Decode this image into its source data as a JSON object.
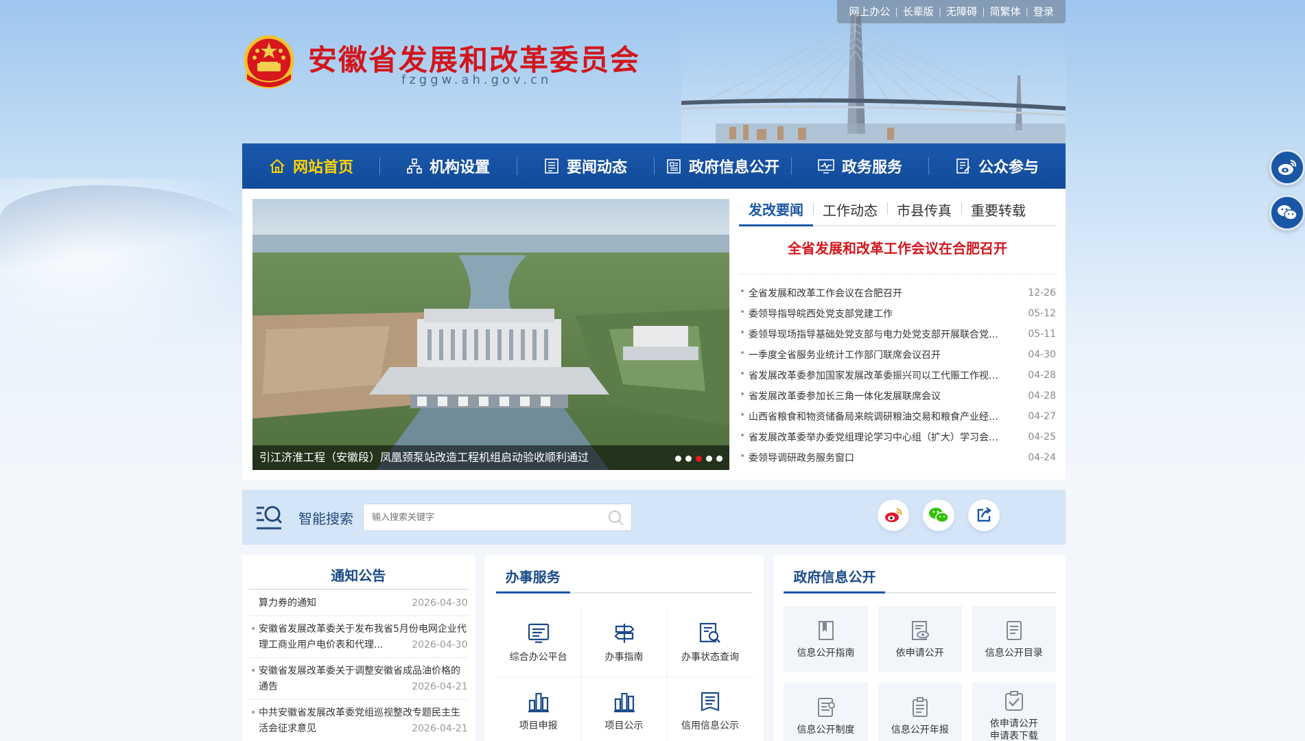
{
  "header": {
    "top_links": [
      "网上办公",
      "长辈版",
      "无障碍",
      "简繁体",
      "登录"
    ],
    "site_title": "安徽省发展和改革委员会",
    "site_domain": "fzggw.ah.gov.cn"
  },
  "nav": {
    "items": [
      {
        "label": "网站首页",
        "icon": "home-icon",
        "active": true
      },
      {
        "label": "机构设置",
        "icon": "org-chart-icon"
      },
      {
        "label": "要闻动态",
        "icon": "news-icon"
      },
      {
        "label": "政府信息公开",
        "icon": "document-icon"
      },
      {
        "label": "政务服务",
        "icon": "monitor-icon"
      },
      {
        "label": "公众参与",
        "icon": "feedback-icon"
      }
    ]
  },
  "slider": {
    "caption": "引江济淮工程（安徽段）凤凰颈泵站改造工程机组启动验收顺利通过",
    "dot_count": 5,
    "active_dot": 2
  },
  "news": {
    "tabs": [
      "发改要闻",
      "工作动态",
      "市县传真",
      "重要转载"
    ],
    "headline": "全省发展和改革工作会议在合肥召开",
    "items": [
      {
        "title": "全省发展和改革工作会议在合肥召开",
        "date": "12-26"
      },
      {
        "title": "委领导指导皖西处党支部党建工作",
        "date": "05-12"
      },
      {
        "title": "委领导现场指导基础处党支部与电力处党支部开展联合党日...",
        "date": "05-11"
      },
      {
        "title": "一季度全省服务业统计工作部门联席会议召开",
        "date": "04-30"
      },
      {
        "title": "省发展改革委参加国家发展改革委振兴司以工代赈工作视频...",
        "date": "04-28"
      },
      {
        "title": "省发展改革委参加长三角一体化发展联席会议",
        "date": "04-28"
      },
      {
        "title": "山西省粮食和物资储备局来皖调研粮油交易和粮食产业经济...",
        "date": "04-27"
      },
      {
        "title": "省发展改革委举办委党组理论学习中心组（扩大）学习会暨...",
        "date": "04-25"
      },
      {
        "title": "委领导调研政务服务窗口",
        "date": "04-24"
      }
    ]
  },
  "search": {
    "label": "智能搜索",
    "placeholder": "输入搜索关键字"
  },
  "notice": {
    "title": "通知公告",
    "items": [
      {
        "title": "算力券的通知",
        "date": "2026-04-30",
        "bullet": false
      },
      {
        "title": "安徽省发展改革委关于发布我省5月份电网企业代理工商业用户电价表和代理...",
        "date": "2026-04-30",
        "bullet": true
      },
      {
        "title": "安徽省发展改革委关于调整安徽省成品油价格的通告",
        "date": "2026-04-21",
        "bullet": true
      },
      {
        "title": "中共安徽省发展改革委党组巡视整改专题民主生活会征求意见",
        "date": "2026-04-21",
        "bullet": true
      }
    ]
  },
  "service": {
    "title": "办事服务",
    "items": [
      {
        "label": "综合办公平台",
        "icon": "office-platform-icon"
      },
      {
        "label": "办事指南",
        "icon": "signpost-icon"
      },
      {
        "label": "办事状态查询",
        "icon": "search-document-icon"
      },
      {
        "label": "项目申报",
        "icon": "bar-chart-icon"
      },
      {
        "label": "项目公示",
        "icon": "bar-chart-icon"
      },
      {
        "label": "信用信息公示",
        "icon": "credit-document-icon"
      }
    ]
  },
  "gov_info": {
    "title": "政府信息公开",
    "items": [
      {
        "label": "信息公开指南",
        "icon": "guide-book-icon"
      },
      {
        "label": "依申请公开",
        "icon": "eye-document-icon"
      },
      {
        "label": "信息公开目录",
        "icon": "catalog-icon"
      },
      {
        "label": "信息公开制度",
        "icon": "policy-document-icon"
      },
      {
        "label": "信息公开年报",
        "icon": "annual-report-icon"
      },
      {
        "label": "依申请公开申请表下载",
        "icon": "checklist-icon"
      }
    ]
  },
  "colors": {
    "nav_blue": "#1a56a6",
    "title_red": "#d2161c",
    "active_gold": "#ffd400"
  }
}
